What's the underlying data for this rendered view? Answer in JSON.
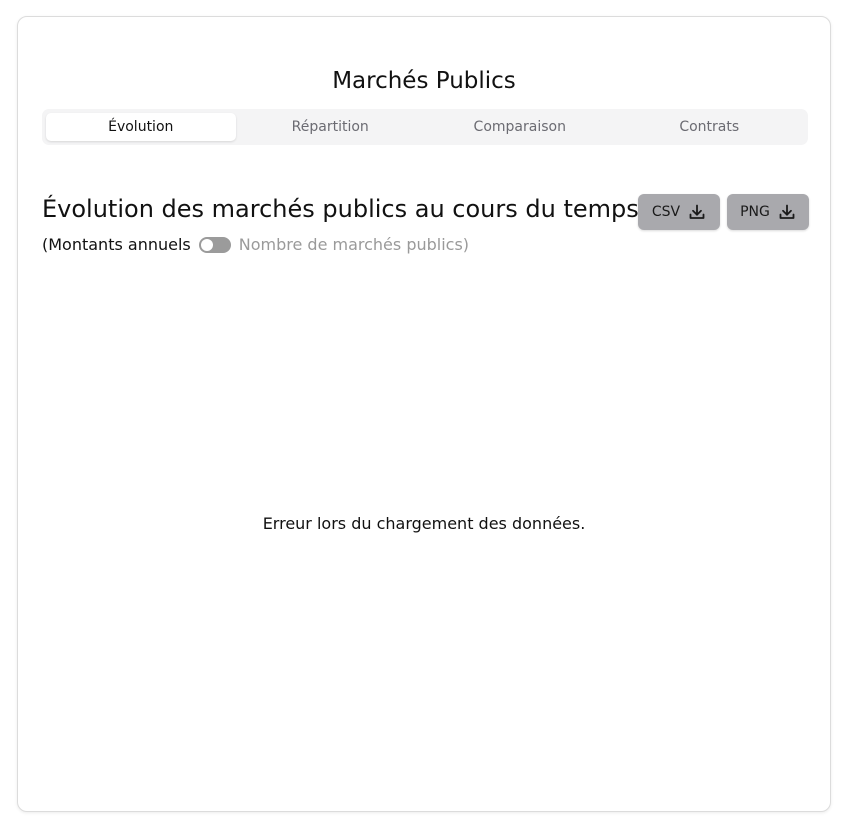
{
  "app": {
    "title": "Marchés Publics"
  },
  "tabs": [
    {
      "label": "Évolution",
      "active": true
    },
    {
      "label": "Répartition",
      "active": false
    },
    {
      "label": "Comparaison",
      "active": false
    },
    {
      "label": "Contrats",
      "active": false
    }
  ],
  "section": {
    "title": "Évolution des marchés publics au cours du temps"
  },
  "toolbar": {
    "csv_label": "CSV",
    "png_label": "PNG",
    "icon": "download-icon",
    "button_color": "#a9a9ad"
  },
  "toggle": {
    "left_label": "(Montants annuels",
    "right_label": "Nombre de marchés publics)",
    "checked": false
  },
  "status": {
    "error_message": "Erreur lors du chargement des données."
  }
}
